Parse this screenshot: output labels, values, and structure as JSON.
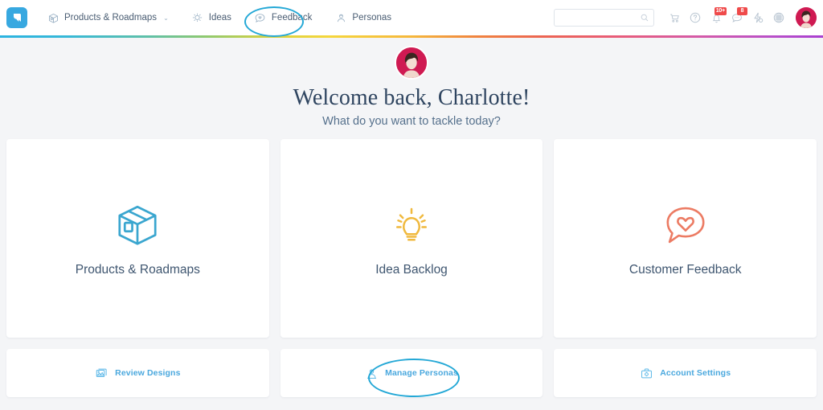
{
  "app": {
    "logo_name": "aha-logo",
    "brand_color": "#37a8e0",
    "highlight_color": "#24a8d6"
  },
  "header": {
    "nav": [
      {
        "label": "Products & Roadmaps",
        "icon": "box-icon",
        "has_caret": true,
        "caret": "⌄",
        "active": false
      },
      {
        "label": "Ideas",
        "icon": "lightbulb-icon",
        "has_caret": false,
        "caret": "",
        "active": false
      },
      {
        "label": "Feedback",
        "icon": "feedback-bubble-icon",
        "has_caret": false,
        "caret": "",
        "active": false
      },
      {
        "label": "Personas",
        "icon": "persona-icon",
        "has_caret": false,
        "caret": "",
        "active": true
      }
    ],
    "search": {
      "value": "",
      "placeholder": "",
      "icon": "search-icon"
    },
    "tools": [
      {
        "name": "add-to-cart-icon",
        "badge": ""
      },
      {
        "name": "help-question-icon",
        "badge": ""
      },
      {
        "name": "notifications-bell-icon",
        "badge": "10+"
      },
      {
        "name": "comments-bubble-icon",
        "badge": "8"
      },
      {
        "name": "integrations-bolt-icon",
        "badge": ""
      },
      {
        "name": "apps-grid-icon",
        "badge": ""
      }
    ],
    "avatar_name": "user-avatar"
  },
  "welcome": {
    "avatar_name": "welcome-avatar",
    "title": "Welcome back, Charlotte!",
    "subtitle": "What do you want to tackle today?"
  },
  "cards": {
    "primary": [
      {
        "label": "Products & Roadmaps",
        "icon": "box-3d-icon",
        "color": "#3aa6cf"
      },
      {
        "label": "Idea Backlog",
        "icon": "lightbulb-icon",
        "color": "#f0b93e"
      },
      {
        "label": "Customer Feedback",
        "icon": "heart-bubble-icon",
        "color": "#ec7b63"
      }
    ],
    "secondary": [
      {
        "label": "Review Designs",
        "icon": "images-icon",
        "highlighted": false
      },
      {
        "label": "Manage Personas",
        "icon": "persona-icon",
        "highlighted": true
      },
      {
        "label": "Account Settings",
        "icon": "briefcase-gear-icon",
        "highlighted": false
      }
    ]
  }
}
